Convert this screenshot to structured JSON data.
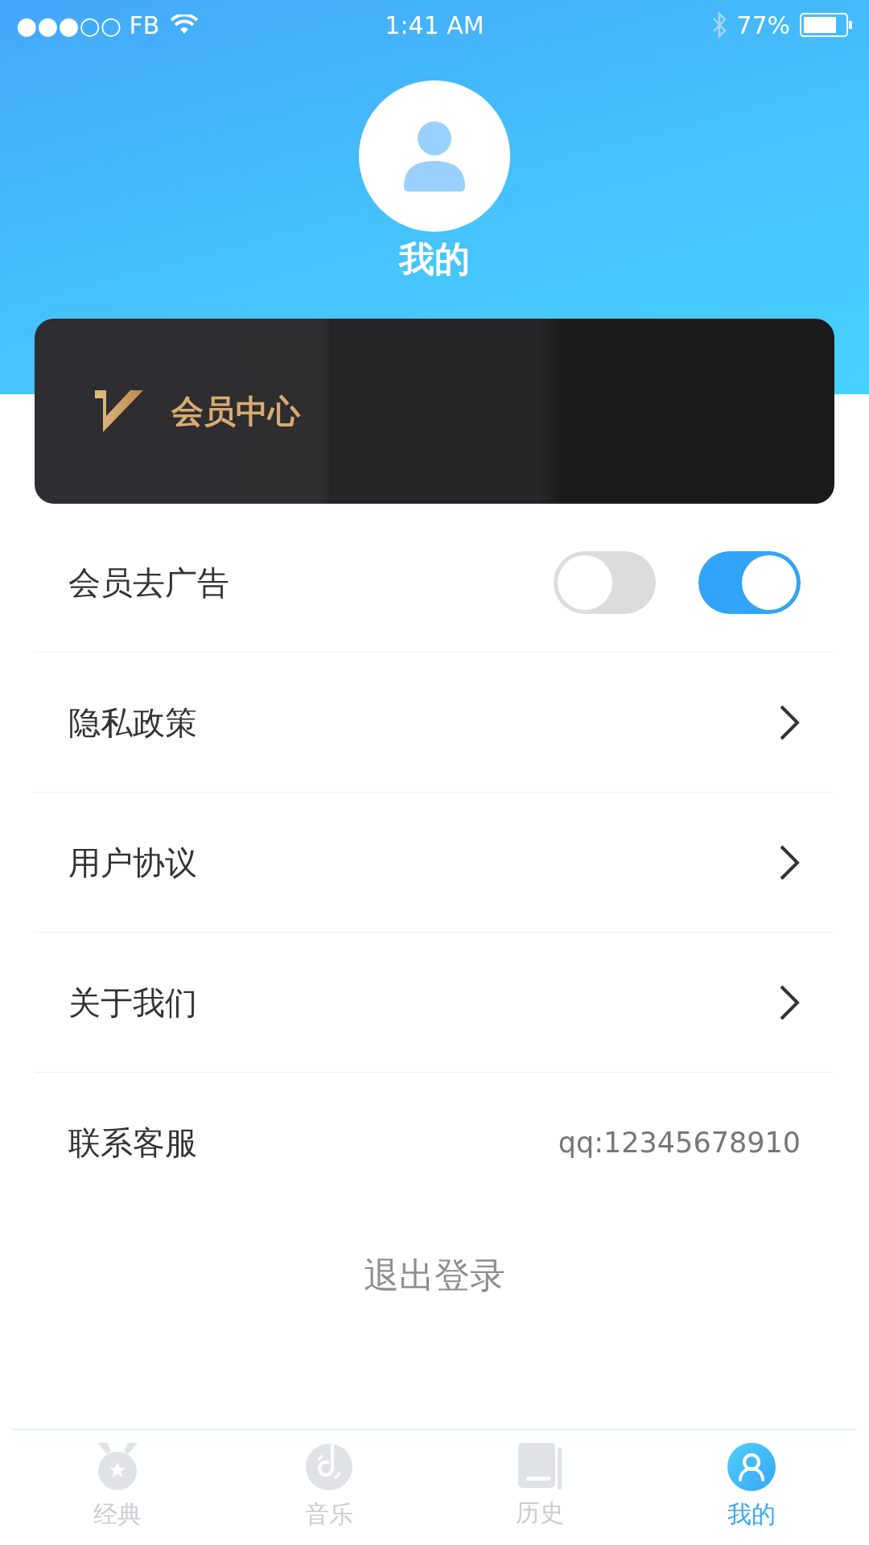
{
  "status_bar": {
    "carrier": "●●●○○ FB",
    "time": "1:41 AM",
    "battery": "77%"
  },
  "profile": {
    "title": "我的"
  },
  "member_card": {
    "label": "会员中心"
  },
  "settings": [
    {
      "kind": "toggles",
      "label": "会员去广告",
      "toggles": [
        {
          "on": false
        },
        {
          "on": true
        }
      ]
    },
    {
      "kind": "link",
      "label": "隐私政策"
    },
    {
      "kind": "link",
      "label": "用户协议"
    },
    {
      "kind": "link",
      "label": "关于我们"
    },
    {
      "kind": "value",
      "label": "联系客服",
      "value": "qq:12345678910"
    }
  ],
  "logout": "退出登录",
  "tab_bar": [
    {
      "label": "经典",
      "selected": false
    },
    {
      "label": "音乐",
      "selected": false
    },
    {
      "label": "历史",
      "selected": false
    },
    {
      "label": "我的",
      "selected": true
    }
  ]
}
